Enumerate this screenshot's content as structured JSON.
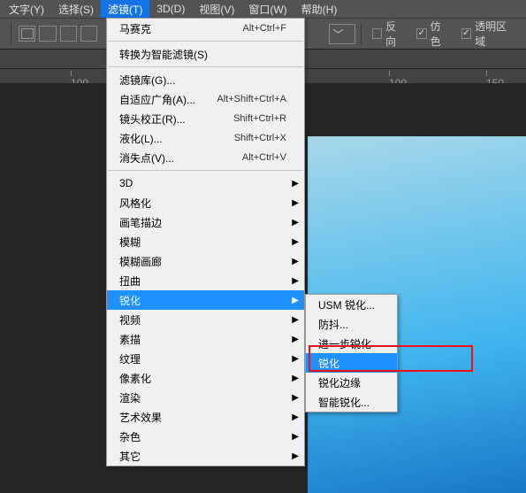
{
  "menubar": {
    "items": [
      {
        "label": "文字(Y)"
      },
      {
        "label": "选择(S)"
      },
      {
        "label": "滤镜(T)"
      },
      {
        "label": "3D(D)"
      },
      {
        "label": "视图(V)"
      },
      {
        "label": "窗口(W)"
      },
      {
        "label": "帮助(H)"
      }
    ],
    "active_index": 2
  },
  "toolbar": {
    "checks": [
      {
        "label": "反向",
        "checked": false
      },
      {
        "label": "仿色",
        "checked": true
      },
      {
        "label": "透明区域",
        "checked": true
      }
    ]
  },
  "ruler": {
    "ticks": [
      {
        "pos": 80,
        "label": "100"
      },
      {
        "pos": 440,
        "label": "100"
      },
      {
        "pos": 550,
        "label": "150"
      }
    ]
  },
  "filter_menu": {
    "top": {
      "label": "马赛克",
      "shortcut": "Alt+Ctrl+F"
    },
    "convert": {
      "label": "转换为智能滤镜(S)"
    },
    "group1": [
      {
        "label": "滤镜库(G)...",
        "shortcut": ""
      },
      {
        "label": "自适应广角(A)...",
        "shortcut": "Alt+Shift+Ctrl+A"
      },
      {
        "label": "镜头校正(R)...",
        "shortcut": "Shift+Ctrl+R"
      },
      {
        "label": "液化(L)...",
        "shortcut": "Shift+Ctrl+X"
      },
      {
        "label": "消失点(V)...",
        "shortcut": "Alt+Ctrl+V"
      }
    ],
    "group2": [
      {
        "label": "3D"
      },
      {
        "label": "风格化"
      },
      {
        "label": "画笔描边"
      },
      {
        "label": "模糊"
      },
      {
        "label": "模糊画廊"
      },
      {
        "label": "扭曲"
      },
      {
        "label": "锐化"
      },
      {
        "label": "视频"
      },
      {
        "label": "素描"
      },
      {
        "label": "纹理"
      },
      {
        "label": "像素化"
      },
      {
        "label": "渲染"
      },
      {
        "label": "艺术效果"
      },
      {
        "label": "杂色"
      },
      {
        "label": "其它"
      }
    ],
    "highlight_index": 6
  },
  "sharpen_submenu": {
    "items": [
      {
        "label": "USM 锐化..."
      },
      {
        "label": "防抖..."
      },
      {
        "label": "进一步锐化"
      },
      {
        "label": "锐化"
      },
      {
        "label": "锐化边缘"
      },
      {
        "label": "智能锐化..."
      }
    ],
    "highlight_index": 3
  }
}
